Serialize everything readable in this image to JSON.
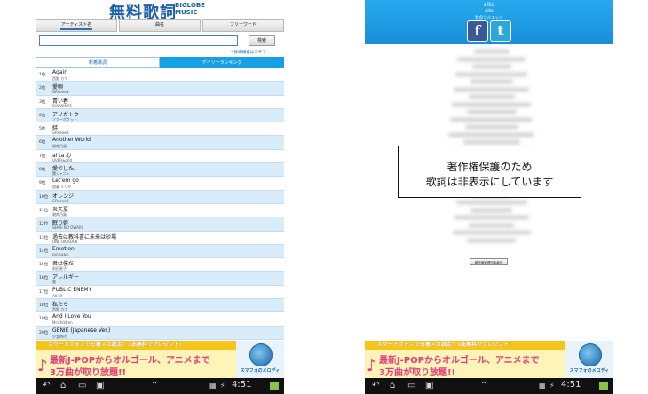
{
  "left": {
    "logo": {
      "main": "無料歌詞",
      "sub_line1": "BIGLOBE",
      "sub_line2": "MUSIC"
    },
    "search_tabs": [
      "アーティスト名",
      "曲名",
      "フリーワード"
    ],
    "search_placeholder": "",
    "search_button": "検索",
    "advanced_link": "→詳細検索はコチラ",
    "rank_tabs": [
      "新着歌詞",
      "デイリーランキング"
    ],
    "ranking": [
      {
        "rank": "1位",
        "title": "Again",
        "artist": "西野 カナ"
      },
      {
        "rank": "2位",
        "title": "愛唄",
        "artist": "GReeeeN"
      },
      {
        "rank": "3位",
        "title": "青い春",
        "artist": "RADWIMPS"
      },
      {
        "rank": "4位",
        "title": "アリガトウ",
        "artist": "ソナーポケット"
      },
      {
        "rank": "5位",
        "title": "絆",
        "artist": "GReeeeN"
      },
      {
        "rank": "6位",
        "title": "Another World",
        "artist": "湘南乃風"
      },
      {
        "rank": "7位",
        "title": "ai ta 心",
        "artist": "UVERworld"
      },
      {
        "rank": "8位",
        "title": "愛でした。",
        "artist": "関ジャニ∞"
      },
      {
        "rank": "9位",
        "title": "Let'em go",
        "artist": "加藤 ミリヤ"
      },
      {
        "rank": "10位",
        "title": "オレンジ",
        "artist": "GReeeeN"
      },
      {
        "rank": "11位",
        "title": "炎天夏",
        "artist": "湘南乃風"
      },
      {
        "rank": "12位",
        "title": "眠り姫",
        "artist": "SEKAI NO OWARI"
      },
      {
        "rank": "13位",
        "title": "過去は教科書に未来は砂場",
        "artist": "ONE OK ROCK"
      },
      {
        "rank": "14位",
        "title": "Emotion",
        "artist": "BIGBANG"
      },
      {
        "rank": "15位",
        "title": "君は僕だ",
        "artist": "前田敦子"
      },
      {
        "rank": "16位",
        "title": "アレルギー",
        "artist": "嵐"
      },
      {
        "rank": "17位",
        "title": "PUBLIC ENEMY",
        "artist": "AK-69"
      },
      {
        "rank": "18位",
        "title": "私たち",
        "artist": "西野 カナ"
      },
      {
        "rank": "19位",
        "title": "And I Love You",
        "artist": "Mr.Children"
      },
      {
        "rank": "20位",
        "title": "GENIE (Japanese Ver.)",
        "artist": "少女時代"
      }
    ],
    "clock": "4:51"
  },
  "right": {
    "header_line1": "aiko",
    "header_line2": "Aiko",
    "header_line3": "秋のシルエット",
    "facebook_letter": "f",
    "twitter_letter": "t",
    "notice_line1": "著作権保護のため",
    "notice_line2": "歌詞は非表示にしています",
    "assoc_button": "著作権管理団体番号",
    "clock": "4:51"
  },
  "ad": {
    "top": "スマートフォンでも着メロ設定！1曲無料でプレゼント！",
    "line1": "最新J-POPからオルゴール、アニメまで",
    "line2": "3万曲が取り放題!!",
    "brand": "スマフォのメロディ"
  },
  "colors": {
    "accent": "#18a0e6",
    "alt_row": "#d8ecf9",
    "ad_yellow": "#f6c51b",
    "ad_pink": "#e23a7a"
  }
}
